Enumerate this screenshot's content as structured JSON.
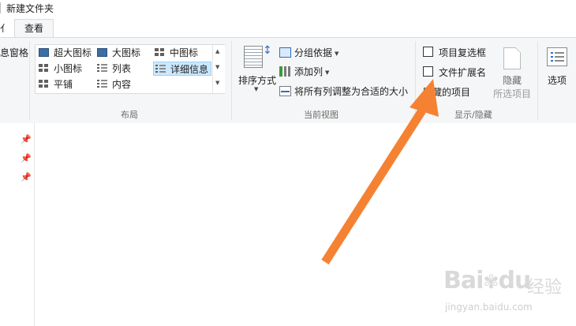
{
  "window": {
    "title": "新建文件夹"
  },
  "ribbon": {
    "tab_partial": "亻",
    "tab_view": "查看",
    "panes_partial": "息窗格",
    "layout": {
      "items": [
        {
          "label": "超大图标",
          "icon": "extra-large-icons-icon"
        },
        {
          "label": "大图标",
          "icon": "large-icons-icon"
        },
        {
          "label": "中图标",
          "icon": "medium-icons-icon"
        },
        {
          "label": "小图标",
          "icon": "small-icons-icon"
        },
        {
          "label": "列表",
          "icon": "list-icon"
        },
        {
          "label": "详细信息",
          "icon": "details-icon",
          "selected": true
        },
        {
          "label": "平铺",
          "icon": "tiles-icon"
        },
        {
          "label": "内容",
          "icon": "content-icon"
        }
      ],
      "group_label": "布局"
    },
    "current_view": {
      "sort_by": "排序方式",
      "group_by": "分组依据",
      "add_columns": "添加列",
      "fit_columns": "将所有列调整为合适的大小",
      "group_label": "当前视图"
    },
    "show_hide": {
      "item_checkboxes": "项目复选框",
      "file_extensions": "文件扩展名",
      "hidden_items": "隐藏的项目",
      "hide_label": "隐藏",
      "selected_items_label": "所选项目",
      "group_label": "显示/隐藏"
    },
    "options": "选项"
  },
  "watermark": {
    "logo": "Bai",
    "logo_tail": "du",
    "suffix": "经验",
    "url": "jingyan.baidu.com"
  },
  "colors": {
    "arrow": "#f58232",
    "selection": "#cce8ff",
    "accent": "#2b70c9"
  }
}
